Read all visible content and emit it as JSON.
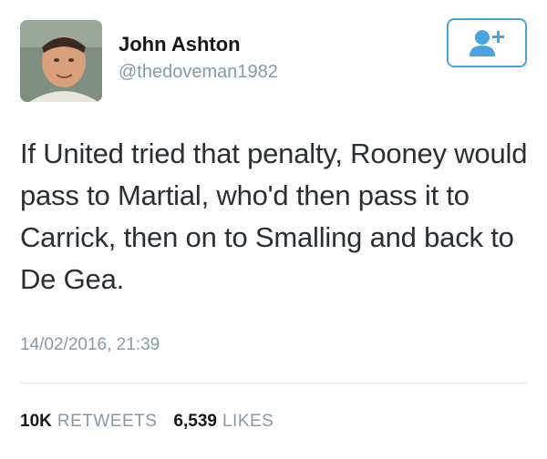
{
  "author": {
    "name": "John Ashton",
    "handle": "@thedoveman1982"
  },
  "follow_button": {
    "icon": "follow-user-icon",
    "color": "#4aa3df"
  },
  "tweet": {
    "text": "If United tried that penalty, Rooney would pass to Martial, who'd then pass it to Carrick, then on to Smalling and back to De Gea.",
    "timestamp": "14/02/2016, 21:39"
  },
  "stats": {
    "retweets_count": "10K",
    "retweets_label": "RETWEETS",
    "likes_count": "6,539",
    "likes_label": "LIKES"
  }
}
